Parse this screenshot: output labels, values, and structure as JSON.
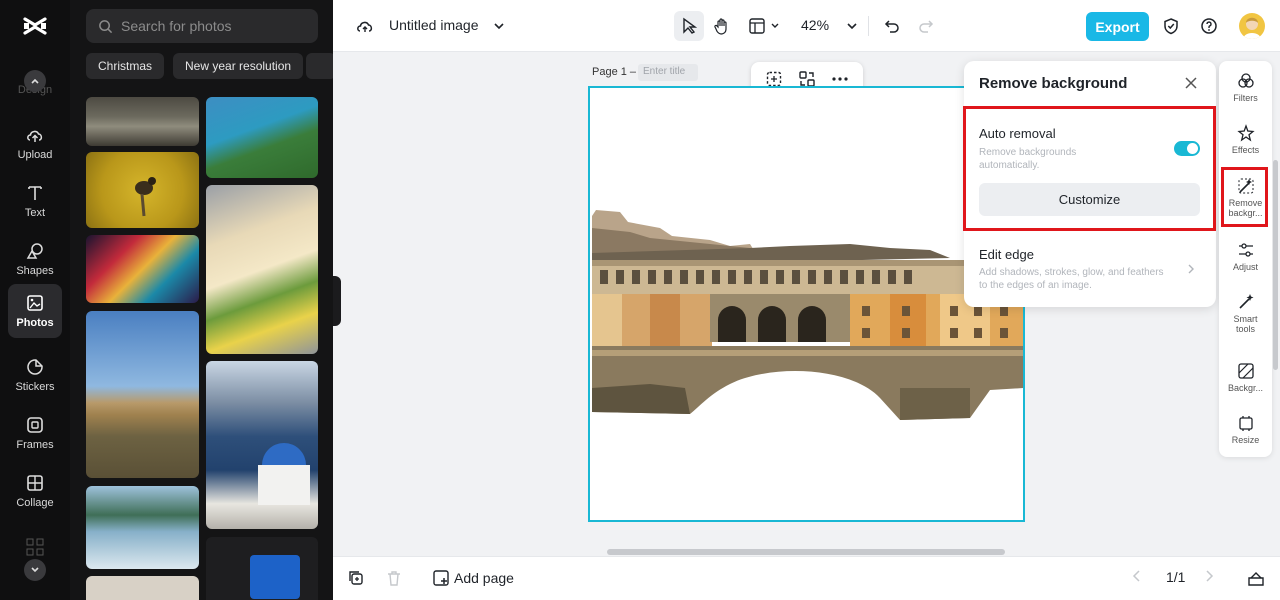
{
  "rail": {
    "ghost_label": "Design",
    "items": [
      {
        "label": "Upload",
        "icon": "upload-cloud-icon"
      },
      {
        "label": "Text",
        "icon": "text-icon"
      },
      {
        "label": "Shapes",
        "icon": "shapes-icon"
      },
      {
        "label": "Photos",
        "icon": "photo-icon",
        "active": true
      },
      {
        "label": "Stickers",
        "icon": "sticker-icon"
      },
      {
        "label": "Frames",
        "icon": "frame-icon"
      },
      {
        "label": "Collage",
        "icon": "collage-icon"
      }
    ]
  },
  "photos_panel": {
    "search_placeholder": "Search for photos",
    "chips": [
      "Christmas",
      "New year resolution"
    ]
  },
  "topbar": {
    "title": "Untitled image",
    "zoom": "42%",
    "export_label": "Export"
  },
  "canvas": {
    "page_label": "Page 1 –",
    "title_placeholder": "Enter title"
  },
  "bottombar": {
    "add_page_label": "Add page",
    "page_counter": "1/1"
  },
  "remove_bg_panel": {
    "title": "Remove background",
    "auto_removal_title": "Auto removal",
    "auto_removal_desc": "Remove backgrounds automatically.",
    "auto_removal_enabled": true,
    "customize_label": "Customize",
    "edit_edge_title": "Edit edge",
    "edit_edge_desc": "Add shadows, strokes, glow, and feathers to the edges of an image."
  },
  "tools": {
    "items": [
      {
        "label": "Filters",
        "icon": "filters-icon"
      },
      {
        "label": "Effects",
        "icon": "effects-icon"
      },
      {
        "label": "Remove backgr...",
        "icon": "remove-background-icon",
        "active": true
      },
      {
        "label": "Adjust",
        "icon": "adjust-icon"
      },
      {
        "label": "Smart tools",
        "icon": "smart-tools-icon"
      },
      {
        "label": "Backgr...",
        "icon": "background-icon"
      },
      {
        "label": "Resize",
        "icon": "resize-icon"
      }
    ]
  },
  "colors": {
    "accent": "#19b8e6",
    "selection": "#19b8d4",
    "highlight": "#e0161b",
    "rail_bg": "#0f0f10"
  }
}
